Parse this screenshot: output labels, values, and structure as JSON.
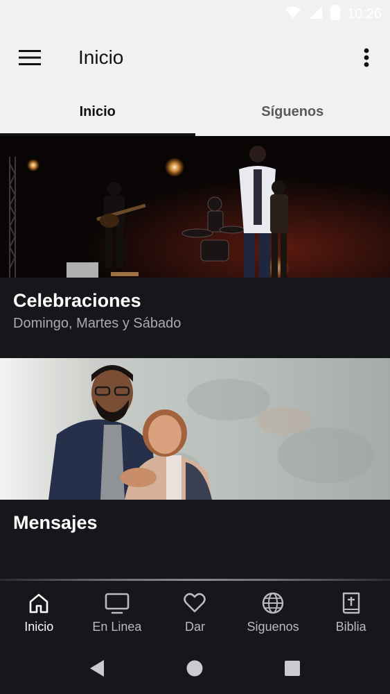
{
  "status_bar": {
    "time": "10:26",
    "icons": [
      "wifi-icon",
      "signal-icon",
      "battery-icon"
    ]
  },
  "app_bar": {
    "title": "Inicio",
    "menu_icon": "hamburger-menu-icon",
    "more_icon": "more-vert-icon"
  },
  "tabs": [
    {
      "label": "Inicio",
      "active": true
    },
    {
      "label": "Síguenos",
      "active": false
    }
  ],
  "cards": [
    {
      "title": "Celebraciones",
      "subtitle": "Domingo, Martes y Sábado",
      "image": "worship-band-stage-photo"
    },
    {
      "title": "Mensajes",
      "subtitle": "",
      "image": "pastor-couple-portrait-photo"
    }
  ],
  "bottom_nav": [
    {
      "label": "Inicio",
      "icon": "home-icon",
      "active": true
    },
    {
      "label": "En Linea",
      "icon": "tv-icon",
      "active": false
    },
    {
      "label": "Dar",
      "icon": "heart-icon",
      "active": false
    },
    {
      "label": "Siguenos",
      "icon": "globe-icon",
      "active": false
    },
    {
      "label": "Biblia",
      "icon": "bible-icon",
      "active": false
    }
  ],
  "system_nav": [
    "back-icon",
    "home-circle-icon",
    "recents-icon"
  ],
  "colors": {
    "app_bar_bg": "#f1f1f1",
    "content_bg": "#15171b",
    "primary_text": "#111111",
    "nav_active": "#ffffff",
    "nav_inactive": "#b9bbbf"
  }
}
